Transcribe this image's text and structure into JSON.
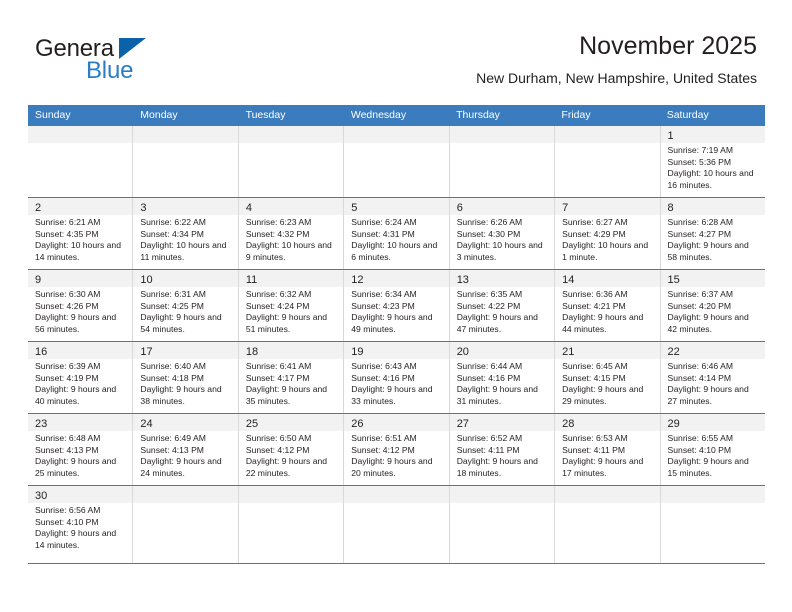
{
  "logo": {
    "line1": "General",
    "line2": "Blue",
    "triangle_color": "#0b62ab",
    "blue_text_color": "#2b7dc4"
  },
  "header": {
    "title": "November 2025",
    "subtitle": "New Durham, New Hampshire, United States"
  },
  "theme": {
    "header_blue": "#3b7cbf",
    "daynum_band": "#f2f2f2",
    "cell_divider": "#d9d9d9",
    "text": "#231f20"
  },
  "calendar": {
    "weekdays": [
      "Sunday",
      "Monday",
      "Tuesday",
      "Wednesday",
      "Thursday",
      "Friday",
      "Saturday"
    ],
    "weeks": [
      [
        {
          "day": "",
          "sunrise": "",
          "sunset": "",
          "daylight": ""
        },
        {
          "day": "",
          "sunrise": "",
          "sunset": "",
          "daylight": ""
        },
        {
          "day": "",
          "sunrise": "",
          "sunset": "",
          "daylight": ""
        },
        {
          "day": "",
          "sunrise": "",
          "sunset": "",
          "daylight": ""
        },
        {
          "day": "",
          "sunrise": "",
          "sunset": "",
          "daylight": ""
        },
        {
          "day": "",
          "sunrise": "",
          "sunset": "",
          "daylight": ""
        },
        {
          "day": "1",
          "sunrise": "Sunrise: 7:19 AM",
          "sunset": "Sunset: 5:36 PM",
          "daylight": "Daylight: 10 hours and 16 minutes."
        }
      ],
      [
        {
          "day": "2",
          "sunrise": "Sunrise: 6:21 AM",
          "sunset": "Sunset: 4:35 PM",
          "daylight": "Daylight: 10 hours and 14 minutes."
        },
        {
          "day": "3",
          "sunrise": "Sunrise: 6:22 AM",
          "sunset": "Sunset: 4:34 PM",
          "daylight": "Daylight: 10 hours and 11 minutes."
        },
        {
          "day": "4",
          "sunrise": "Sunrise: 6:23 AM",
          "sunset": "Sunset: 4:32 PM",
          "daylight": "Daylight: 10 hours and 9 minutes."
        },
        {
          "day": "5",
          "sunrise": "Sunrise: 6:24 AM",
          "sunset": "Sunset: 4:31 PM",
          "daylight": "Daylight: 10 hours and 6 minutes."
        },
        {
          "day": "6",
          "sunrise": "Sunrise: 6:26 AM",
          "sunset": "Sunset: 4:30 PM",
          "daylight": "Daylight: 10 hours and 3 minutes."
        },
        {
          "day": "7",
          "sunrise": "Sunrise: 6:27 AM",
          "sunset": "Sunset: 4:29 PM",
          "daylight": "Daylight: 10 hours and 1 minute."
        },
        {
          "day": "8",
          "sunrise": "Sunrise: 6:28 AM",
          "sunset": "Sunset: 4:27 PM",
          "daylight": "Daylight: 9 hours and 58 minutes."
        }
      ],
      [
        {
          "day": "9",
          "sunrise": "Sunrise: 6:30 AM",
          "sunset": "Sunset: 4:26 PM",
          "daylight": "Daylight: 9 hours and 56 minutes."
        },
        {
          "day": "10",
          "sunrise": "Sunrise: 6:31 AM",
          "sunset": "Sunset: 4:25 PM",
          "daylight": "Daylight: 9 hours and 54 minutes."
        },
        {
          "day": "11",
          "sunrise": "Sunrise: 6:32 AM",
          "sunset": "Sunset: 4:24 PM",
          "daylight": "Daylight: 9 hours and 51 minutes."
        },
        {
          "day": "12",
          "sunrise": "Sunrise: 6:34 AM",
          "sunset": "Sunset: 4:23 PM",
          "daylight": "Daylight: 9 hours and 49 minutes."
        },
        {
          "day": "13",
          "sunrise": "Sunrise: 6:35 AM",
          "sunset": "Sunset: 4:22 PM",
          "daylight": "Daylight: 9 hours and 47 minutes."
        },
        {
          "day": "14",
          "sunrise": "Sunrise: 6:36 AM",
          "sunset": "Sunset: 4:21 PM",
          "daylight": "Daylight: 9 hours and 44 minutes."
        },
        {
          "day": "15",
          "sunrise": "Sunrise: 6:37 AM",
          "sunset": "Sunset: 4:20 PM",
          "daylight": "Daylight: 9 hours and 42 minutes."
        }
      ],
      [
        {
          "day": "16",
          "sunrise": "Sunrise: 6:39 AM",
          "sunset": "Sunset: 4:19 PM",
          "daylight": "Daylight: 9 hours and 40 minutes."
        },
        {
          "day": "17",
          "sunrise": "Sunrise: 6:40 AM",
          "sunset": "Sunset: 4:18 PM",
          "daylight": "Daylight: 9 hours and 38 minutes."
        },
        {
          "day": "18",
          "sunrise": "Sunrise: 6:41 AM",
          "sunset": "Sunset: 4:17 PM",
          "daylight": "Daylight: 9 hours and 35 minutes."
        },
        {
          "day": "19",
          "sunrise": "Sunrise: 6:43 AM",
          "sunset": "Sunset: 4:16 PM",
          "daylight": "Daylight: 9 hours and 33 minutes."
        },
        {
          "day": "20",
          "sunrise": "Sunrise: 6:44 AM",
          "sunset": "Sunset: 4:16 PM",
          "daylight": "Daylight: 9 hours and 31 minutes."
        },
        {
          "day": "21",
          "sunrise": "Sunrise: 6:45 AM",
          "sunset": "Sunset: 4:15 PM",
          "daylight": "Daylight: 9 hours and 29 minutes."
        },
        {
          "day": "22",
          "sunrise": "Sunrise: 6:46 AM",
          "sunset": "Sunset: 4:14 PM",
          "daylight": "Daylight: 9 hours and 27 minutes."
        }
      ],
      [
        {
          "day": "23",
          "sunrise": "Sunrise: 6:48 AM",
          "sunset": "Sunset: 4:13 PM",
          "daylight": "Daylight: 9 hours and 25 minutes."
        },
        {
          "day": "24",
          "sunrise": "Sunrise: 6:49 AM",
          "sunset": "Sunset: 4:13 PM",
          "daylight": "Daylight: 9 hours and 24 minutes."
        },
        {
          "day": "25",
          "sunrise": "Sunrise: 6:50 AM",
          "sunset": "Sunset: 4:12 PM",
          "daylight": "Daylight: 9 hours and 22 minutes."
        },
        {
          "day": "26",
          "sunrise": "Sunrise: 6:51 AM",
          "sunset": "Sunset: 4:12 PM",
          "daylight": "Daylight: 9 hours and 20 minutes."
        },
        {
          "day": "27",
          "sunrise": "Sunrise: 6:52 AM",
          "sunset": "Sunset: 4:11 PM",
          "daylight": "Daylight: 9 hours and 18 minutes."
        },
        {
          "day": "28",
          "sunrise": "Sunrise: 6:53 AM",
          "sunset": "Sunset: 4:11 PM",
          "daylight": "Daylight: 9 hours and 17 minutes."
        },
        {
          "day": "29",
          "sunrise": "Sunrise: 6:55 AM",
          "sunset": "Sunset: 4:10 PM",
          "daylight": "Daylight: 9 hours and 15 minutes."
        }
      ],
      [
        {
          "day": "30",
          "sunrise": "Sunrise: 6:56 AM",
          "sunset": "Sunset: 4:10 PM",
          "daylight": "Daylight: 9 hours and 14 minutes."
        },
        {
          "day": "",
          "sunrise": "",
          "sunset": "",
          "daylight": ""
        },
        {
          "day": "",
          "sunrise": "",
          "sunset": "",
          "daylight": ""
        },
        {
          "day": "",
          "sunrise": "",
          "sunset": "",
          "daylight": ""
        },
        {
          "day": "",
          "sunrise": "",
          "sunset": "",
          "daylight": ""
        },
        {
          "day": "",
          "sunrise": "",
          "sunset": "",
          "daylight": ""
        },
        {
          "day": "",
          "sunrise": "",
          "sunset": "",
          "daylight": ""
        }
      ]
    ]
  }
}
